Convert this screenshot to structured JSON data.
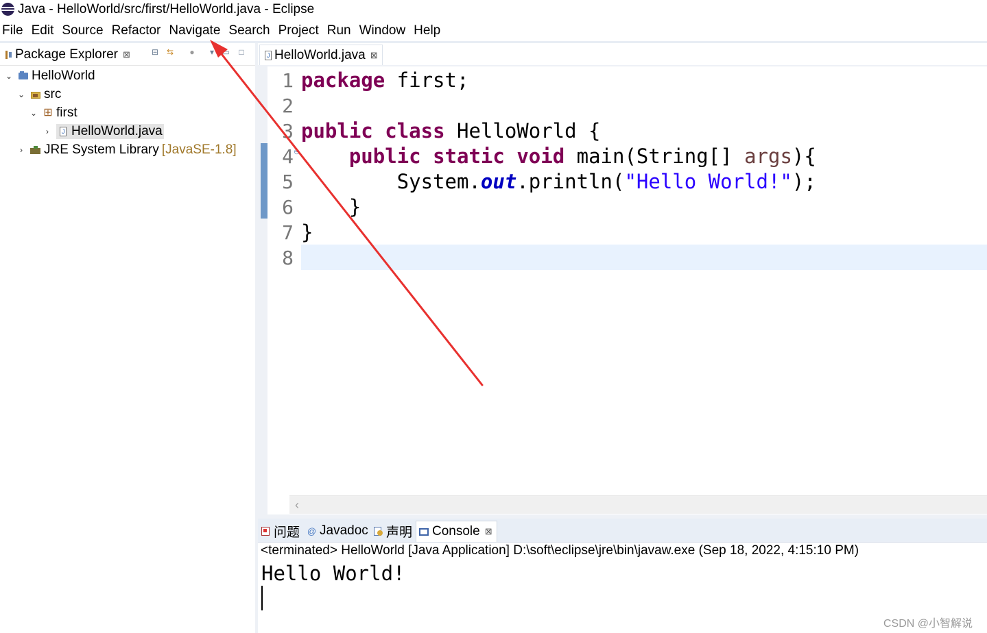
{
  "window": {
    "title": "Java - HelloWorld/src/first/HelloWorld.java - Eclipse"
  },
  "menu": [
    "File",
    "Edit",
    "Source",
    "Refactor",
    "Navigate",
    "Search",
    "Project",
    "Run",
    "Window",
    "Help"
  ],
  "package_explorer": {
    "tab_label": "Package Explorer",
    "close_glyph": "⊠",
    "tree": {
      "project": "HelloWorld",
      "src_folder": "src",
      "package": "first",
      "file": "HelloWorld.java",
      "library": "JRE System Library",
      "library_decoration": "[JavaSE-1.8]"
    }
  },
  "editor": {
    "tab_label": "HelloWorld.java",
    "line_numbers": [
      "1",
      "2",
      "3",
      "4",
      "5",
      "6",
      "7",
      "8"
    ],
    "code": {
      "l1_kw": "package",
      "l1_rest": " first;",
      "l3_kw1": "public",
      "l3_kw2": "class",
      "l3_rest": " HelloWorld {",
      "l4_indent": "    ",
      "l4_kw1": "public",
      "l4_kw2": "static",
      "l4_kw3": "void",
      "l4_mid": " main(String[] ",
      "l4_var": "args",
      "l4_end": "){",
      "l5_pre": "        System.",
      "l5_field": "out",
      "l5_mid": ".println(",
      "l5_str": "\"Hello World!\"",
      "l5_end": ");",
      "l6": "    }",
      "l7": "}"
    },
    "scroll_left_glyph": "‹"
  },
  "bottom_panel": {
    "tabs": {
      "problems": "问题",
      "javadoc": "Javadoc",
      "declaration": "声明",
      "console": "Console"
    },
    "console_header": "<terminated> HelloWorld [Java Application] D:\\soft\\eclipse\\jre\\bin\\javaw.exe (Sep 18, 2022, 4:15:10 PM)",
    "console_output": "Hello World!"
  },
  "watermark": "CSDN @小智解说",
  "colors": {
    "keyword": "#7f0055",
    "string": "#2a00ff",
    "field": "#0000c0",
    "annotation_arrow": "#e8312f",
    "current_line": "#e8f2fe"
  }
}
